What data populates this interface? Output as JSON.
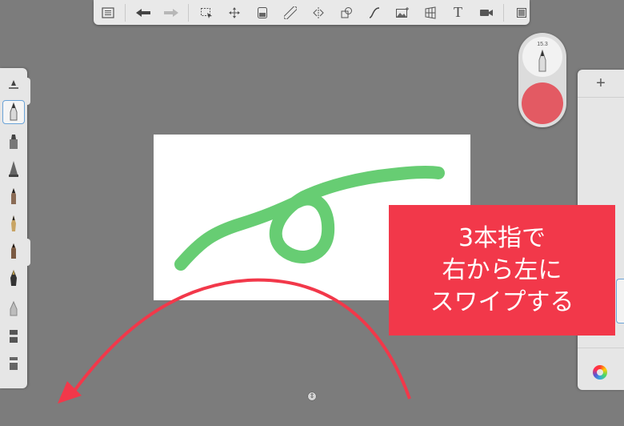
{
  "toolbar": {
    "buttons": [
      {
        "name": "list-icon",
        "glyph": "☰"
      },
      {
        "name": "undo-icon",
        "glyph": "↩"
      },
      {
        "name": "redo-icon",
        "glyph": "↪"
      },
      {
        "name": "selection-icon",
        "glyph": "⬚"
      },
      {
        "name": "transform-icon",
        "glyph": "✥"
      },
      {
        "name": "layer-fill-icon",
        "glyph": "▣"
      },
      {
        "name": "ruler-icon",
        "glyph": "⟋"
      },
      {
        "name": "symmetry-icon",
        "glyph": "⇹"
      },
      {
        "name": "shapes-icon",
        "glyph": "◰"
      },
      {
        "name": "curve-icon",
        "glyph": "∫"
      },
      {
        "name": "image-icon",
        "glyph": "▨"
      },
      {
        "name": "perspective-icon",
        "glyph": "▦"
      },
      {
        "name": "text-tool-icon",
        "glyph": "T"
      },
      {
        "name": "video-icon",
        "glyph": "▶"
      },
      {
        "name": "fullscreen-icon",
        "glyph": "▢"
      }
    ]
  },
  "puck": {
    "brush_size": "15.3",
    "color": "#e35a63"
  },
  "layers": {
    "add_label": "+"
  },
  "annotation": {
    "line1": "3本指で",
    "line2": "右から左に",
    "line3": "スワイプする",
    "background": "#f2384a"
  },
  "stroke_color": "#4cc45a",
  "arrow_color": "#f2384a",
  "center_handle_glyph": "⇕"
}
